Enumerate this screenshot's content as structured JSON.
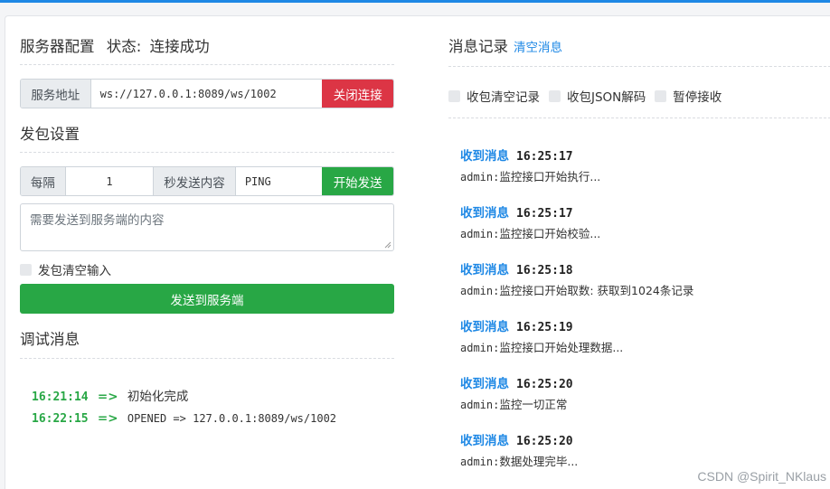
{
  "server_config": {
    "title": "服务器配置",
    "status_label": "状态:",
    "status_value": "连接成功",
    "address_label": "服务地址",
    "address_value": "ws://127.0.0.1:8089/ws/1002",
    "close_button": "关闭连接"
  },
  "send_settings": {
    "title": "发包设置",
    "every_label": "每隔",
    "interval_value": "1",
    "content_label": "秒发送内容",
    "content_value": "PING",
    "start_button": "开始发送",
    "textarea_placeholder": "需要发送到服务端的内容",
    "clear_input_label": "发包清空输入",
    "send_button": "发送到服务端"
  },
  "debug": {
    "title": "调试消息",
    "entries": [
      {
        "time": "16:21:14",
        "arrow": "=>",
        "msg": "初始化完成"
      },
      {
        "time": "16:22:15",
        "arrow": "=>",
        "msg": "OPENED => 127.0.0.1:8089/ws/1002"
      }
    ]
  },
  "messages": {
    "title": "消息记录",
    "clear_link": "清空消息",
    "options": [
      "收包清空记录",
      "收包JSON解码",
      "暂停接收"
    ],
    "entries": [
      {
        "label": "收到消息",
        "time": "16:25:17",
        "user": "admin:",
        "text": "监控接口开始执行..."
      },
      {
        "label": "收到消息",
        "time": "16:25:17",
        "user": "admin:",
        "text": "监控接口开始校验..."
      },
      {
        "label": "收到消息",
        "time": "16:25:18",
        "user": "admin:",
        "text": "监控接口开始取数: 获取到1024条记录"
      },
      {
        "label": "收到消息",
        "time": "16:25:19",
        "user": "admin:",
        "text": "监控接口开始处理数据..."
      },
      {
        "label": "收到消息",
        "time": "16:25:20",
        "user": "admin:",
        "text": "监控一切正常"
      },
      {
        "label": "收到消息",
        "time": "16:25:20",
        "user": "admin:",
        "text": "数据处理完毕..."
      }
    ]
  },
  "watermark": "CSDN @Spirit_NKlaus",
  "colors": {
    "accent": "#1e88e5",
    "danger": "#dc3545",
    "success": "#28a745"
  }
}
